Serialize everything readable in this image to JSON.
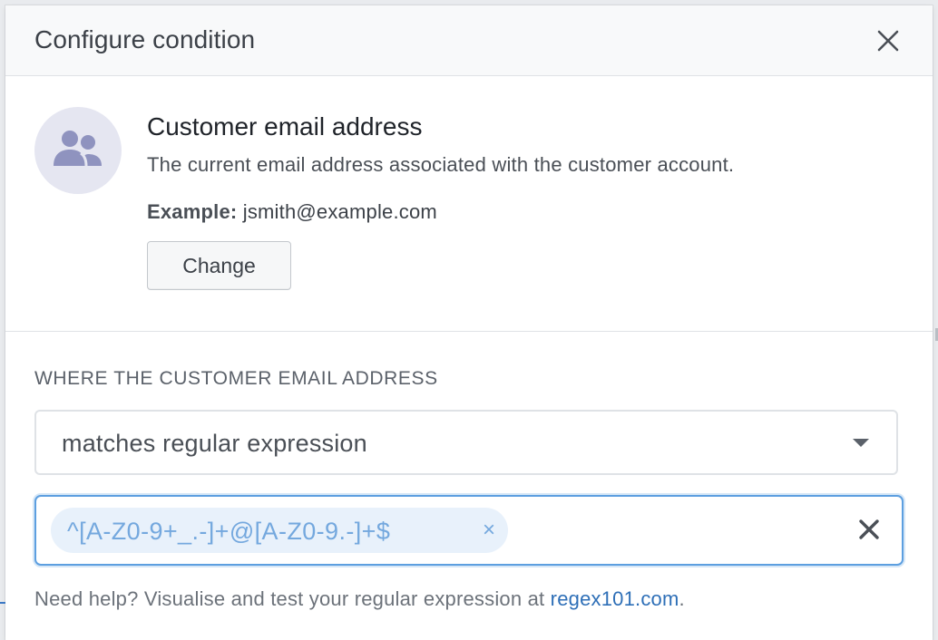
{
  "dialog": {
    "title": "Configure condition"
  },
  "field": {
    "title": "Customer email address",
    "description": "The current email address associated with the customer account.",
    "example_label": "Example:",
    "example_value": "jsmith@example.com",
    "change_label": "Change",
    "icon": "users-icon"
  },
  "condition": {
    "section_label": "WHERE THE CUSTOMER EMAIL ADDRESS",
    "operator": "matches regular expression",
    "values": [
      {
        "text": "^[A-Z0-9+_.-]+@[A-Z0-9.-]+$",
        "remove": "×"
      }
    ]
  },
  "help": {
    "text": "Need help? Visualise and test your regular expression at ",
    "link_text": "regex101.com",
    "suffix": "."
  },
  "colors": {
    "accent": "#5d9fe0",
    "link": "#2e6fb7",
    "chip_bg": "#e8f1fb",
    "chip_text": "#74a8de",
    "avatar_bg": "#e5e6f1",
    "avatar_icon": "#8f93bf"
  }
}
